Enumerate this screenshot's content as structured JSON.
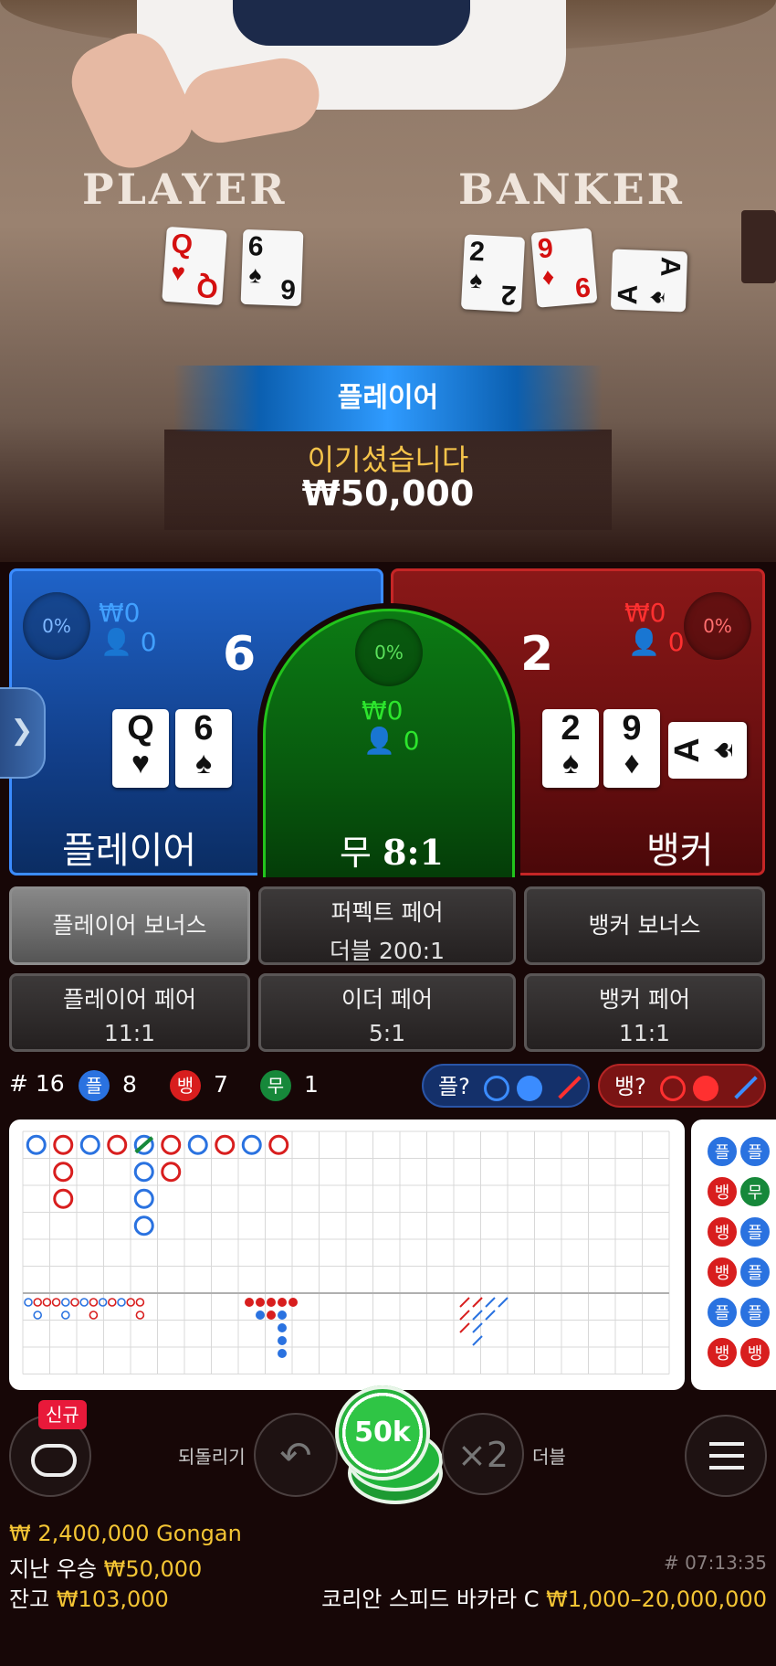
{
  "video": {
    "player_label": "PLAYER",
    "banker_label": "BANKER",
    "player_cards": [
      {
        "rank": "Q",
        "suit": "♥",
        "red": true
      },
      {
        "rank": "6",
        "suit": "♠",
        "red": false
      }
    ],
    "banker_cards": [
      {
        "rank": "2",
        "suit": "♠",
        "red": false
      },
      {
        "rank": "9",
        "suit": "♦",
        "red": true
      },
      {
        "rank": "A",
        "suit": "♠",
        "red": false
      }
    ],
    "result_label": "플레이어",
    "win_text": "이기셨습니다",
    "win_amount": "₩50,000"
  },
  "areas": {
    "player": {
      "pct": "0%",
      "bet": "₩0",
      "players": "0",
      "score": "6",
      "label": "플레이어",
      "cards": [
        {
          "rank": "Q",
          "suit": "♥",
          "red": true
        },
        {
          "rank": "6",
          "suit": "♠",
          "red": false
        }
      ]
    },
    "tie": {
      "pct": "0%",
      "bet": "₩0",
      "players": "0",
      "label": "무",
      "odds": "8:1"
    },
    "banker": {
      "pct": "0%",
      "bet": "₩0",
      "players": "0",
      "score": "2",
      "label": "뱅커",
      "cards": [
        {
          "rank": "2",
          "suit": "♠",
          "red": false
        },
        {
          "rank": "9",
          "suit": "♦",
          "red": true
        },
        {
          "rank": "A",
          "suit": "♠",
          "red": false
        }
      ]
    }
  },
  "side_bets": {
    "player_bonus": "플레이어 보너스",
    "perfect_pair": "퍼펙트 페어",
    "perfect_pair_odds": "더블 200:1",
    "banker_bonus": "뱅커 보너스",
    "player_pair": "플레이어 페어",
    "player_pair_odds": "11:1",
    "either_pair": "이더 페어",
    "either_pair_odds": "5:1",
    "banker_pair": "뱅커 페어",
    "banker_pair_odds": "11:1"
  },
  "stats": {
    "round": "# 16",
    "player_short": "플",
    "player_count": "8",
    "banker_short": "뱅",
    "banker_count": "7",
    "tie_short": "무",
    "tie_count": "1",
    "player_ask": "플?",
    "banker_ask": "뱅?"
  },
  "big_road": [
    {
      "col": 0,
      "row": 0,
      "c": "P"
    },
    {
      "col": 1,
      "row": 0,
      "c": "B"
    },
    {
      "col": 1,
      "row": 1,
      "c": "B"
    },
    {
      "col": 1,
      "row": 2,
      "c": "B"
    },
    {
      "col": 2,
      "row": 0,
      "c": "P"
    },
    {
      "col": 3,
      "row": 0,
      "c": "B"
    },
    {
      "col": 4,
      "row": 0,
      "c": "P",
      "tie": true
    },
    {
      "col": 4,
      "row": 1,
      "c": "P"
    },
    {
      "col": 4,
      "row": 2,
      "c": "P"
    },
    {
      "col": 4,
      "row": 3,
      "c": "P"
    },
    {
      "col": 5,
      "row": 0,
      "c": "B"
    },
    {
      "col": 5,
      "row": 1,
      "c": "B"
    },
    {
      "col": 6,
      "row": 0,
      "c": "P"
    },
    {
      "col": 7,
      "row": 0,
      "c": "B"
    },
    {
      "col": 8,
      "row": 0,
      "c": "P"
    },
    {
      "col": 9,
      "row": 0,
      "c": "B"
    }
  ],
  "bead_road": [
    {
      "t": "플",
      "c": "P"
    },
    {
      "t": "뱅",
      "c": "B"
    },
    {
      "t": "뱅",
      "c": "B"
    },
    {
      "t": "뱅",
      "c": "B"
    },
    {
      "t": "플",
      "c": "P"
    },
    {
      "t": "뱅",
      "c": "B"
    },
    {
      "t": "플",
      "c": "P"
    },
    {
      "t": "무",
      "c": "T"
    },
    {
      "t": "플",
      "c": "P"
    },
    {
      "t": "플",
      "c": "P"
    },
    {
      "t": "플",
      "c": "P"
    },
    {
      "t": "뱅",
      "c": "B"
    }
  ],
  "controls": {
    "new_badge": "신규",
    "undo_label": "되돌리기",
    "chip_value": "50k",
    "double_icon": "×2",
    "double_label": "더블"
  },
  "footer": {
    "bet_line": "₩ 2,400,000 Gongan",
    "last_win_label": "지난 우승",
    "last_win_amount": "₩50,000",
    "balance_label": "잔고",
    "balance_amount": "₩103,000",
    "round_id": "# 07:13:35",
    "table_name": "코리안 스피드 바카라 C",
    "limits": "₩1,000–20,000,000"
  },
  "colors": {
    "player": "#1f63c8",
    "banker": "#8a1818",
    "tie": "#0c7a14",
    "gold": "#f4c534"
  }
}
